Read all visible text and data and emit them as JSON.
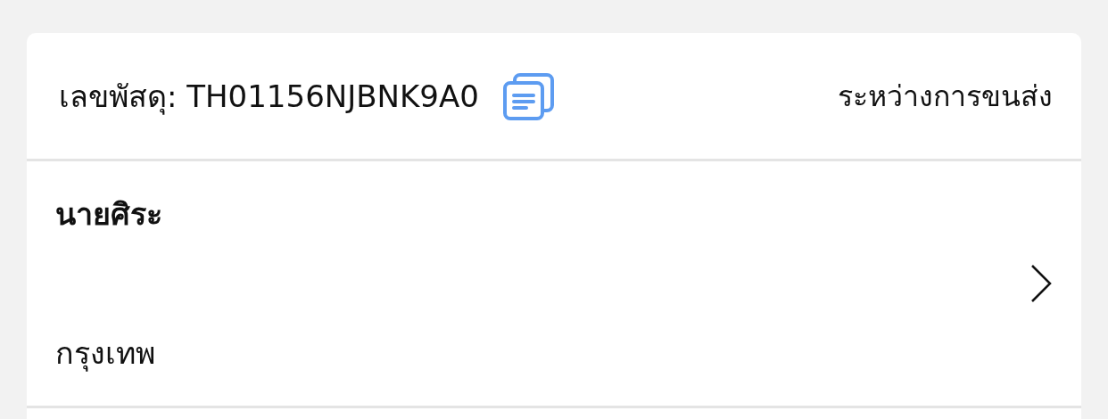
{
  "parcel": {
    "tracking": "เลขพัสดุ: TH01156NJBNK9A0",
    "status": "ระหว่างการขนส่ง"
  },
  "recipient": {
    "name": "นายศิระ",
    "city": "กรุงเทพ"
  }
}
